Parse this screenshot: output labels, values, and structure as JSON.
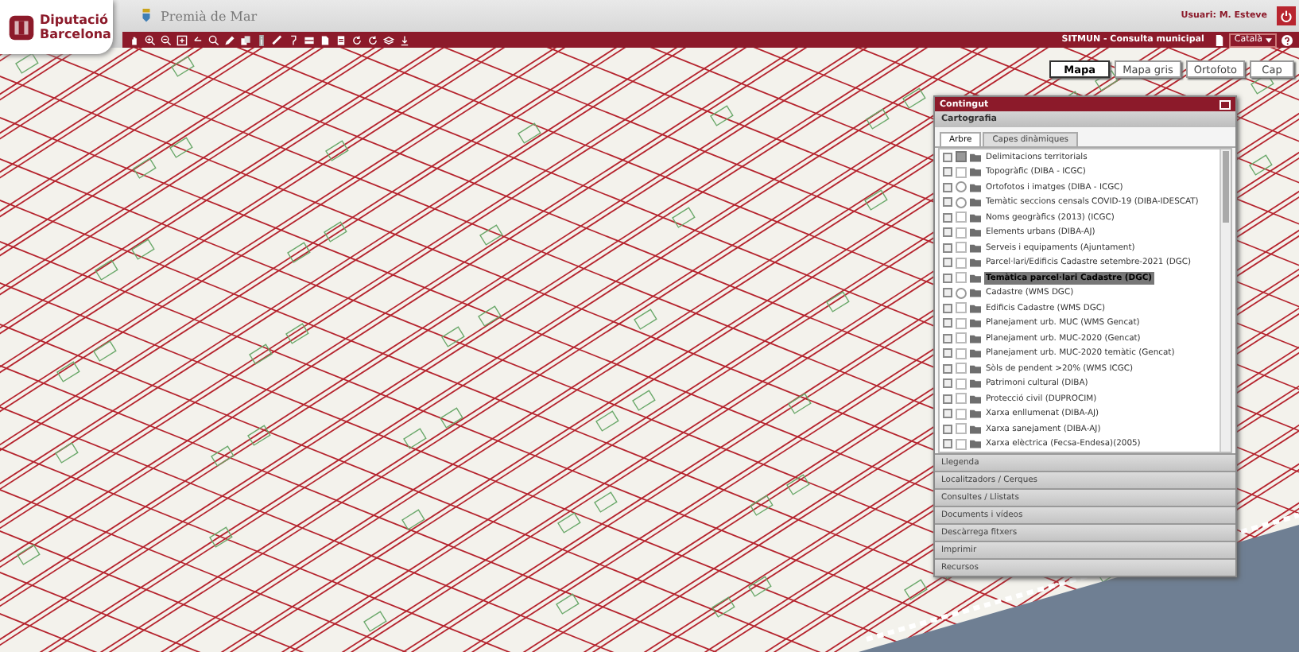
{
  "header": {
    "org_name": [
      "Diputació",
      "Barcelona"
    ],
    "municipality": "Premià de Mar",
    "user": "Usuari: M. Esteve",
    "app_title": "SITMUN - Consulta municipal",
    "language": "Català"
  },
  "basemaps": [
    {
      "label": "Mapa",
      "selected": true
    },
    {
      "label": "Mapa gris",
      "selected": false
    },
    {
      "label": "Ortofoto",
      "selected": false
    },
    {
      "label": "Cap",
      "selected": false
    }
  ],
  "panel": {
    "title": "Contingut",
    "section": "Cartografia",
    "tabs": [
      {
        "label": "Arbre",
        "selected": true
      },
      {
        "label": "Capes dinàmiques",
        "selected": false
      }
    ],
    "layers": [
      {
        "kind": "checkbox",
        "checked": true,
        "selected": false,
        "label": "Delimitacions territorials"
      },
      {
        "kind": "checkbox",
        "checked": false,
        "selected": false,
        "label": "Topogràfic (DIBA - ICGC)"
      },
      {
        "kind": "radio",
        "checked": false,
        "selected": false,
        "label": "Ortofotos i imatges (DIBA - ICGC)"
      },
      {
        "kind": "radio",
        "checked": false,
        "selected": false,
        "label": "Temàtic seccions censals COVID-19 (DIBA-IDESCAT)"
      },
      {
        "kind": "checkbox",
        "checked": false,
        "selected": false,
        "label": "Noms geogràfics (2013) (ICGC)"
      },
      {
        "kind": "checkbox",
        "checked": false,
        "selected": false,
        "label": "Elements urbans (DIBA-AJ)"
      },
      {
        "kind": "checkbox",
        "checked": false,
        "selected": false,
        "label": "Serveis i equipaments (Ajuntament)"
      },
      {
        "kind": "checkbox",
        "checked": false,
        "selected": false,
        "label": "Parcel·lari/Edificis Cadastre setembre-2021 (DGC)"
      },
      {
        "kind": "checkbox",
        "checked": false,
        "selected": true,
        "label": "Temàtica parcel·lari Cadastre (DGC)"
      },
      {
        "kind": "radio",
        "checked": false,
        "selected": false,
        "label": "Cadastre (WMS DGC)"
      },
      {
        "kind": "checkbox",
        "checked": false,
        "selected": false,
        "label": "Edificis Cadastre (WMS DGC)"
      },
      {
        "kind": "checkbox",
        "checked": false,
        "selected": false,
        "label": "Planejament urb. MUC (WMS Gencat)"
      },
      {
        "kind": "checkbox",
        "checked": false,
        "selected": false,
        "label": "Planejament urb. MUC-2020 (Gencat)"
      },
      {
        "kind": "checkbox",
        "checked": false,
        "selected": false,
        "label": "Planejament urb. MUC-2020 temàtic (Gencat)"
      },
      {
        "kind": "checkbox",
        "checked": false,
        "selected": false,
        "label": "Sòls de pendent >20% (WMS ICGC)"
      },
      {
        "kind": "checkbox",
        "checked": false,
        "selected": false,
        "label": "Patrimoni cultural (DIBA)"
      },
      {
        "kind": "checkbox",
        "checked": false,
        "selected": false,
        "label": "Protecció civil (DUPROCIM)"
      },
      {
        "kind": "checkbox",
        "checked": false,
        "selected": false,
        "label": "Xarxa enllumenat (DIBA-AJ)"
      },
      {
        "kind": "checkbox",
        "checked": false,
        "selected": false,
        "label": "Xarxa sanejament (DIBA-AJ)"
      },
      {
        "kind": "checkbox",
        "checked": false,
        "selected": false,
        "label": "Xarxa elèctrica (Fecsa-Endesa)(2005)"
      }
    ],
    "sections": [
      "Llegenda",
      "Localitzadors / Cerques",
      "Consultes / Llistats",
      "Documents i vídeos",
      "Descàrrega fitxers",
      "Imprimir",
      "Recursos"
    ]
  }
}
